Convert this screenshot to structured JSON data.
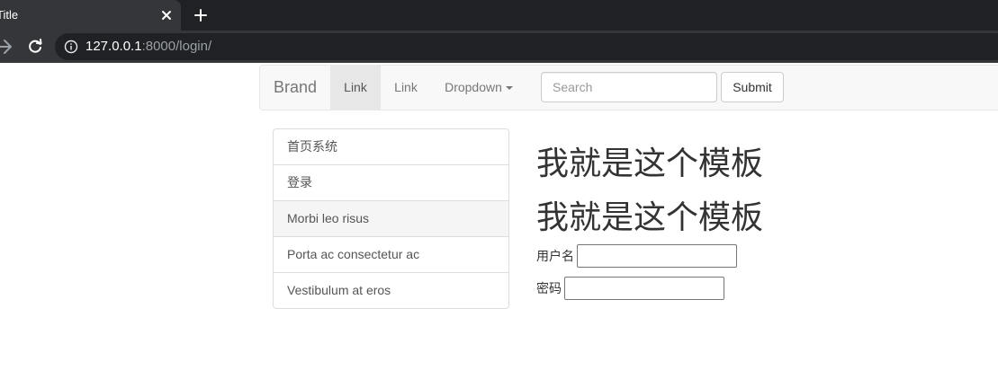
{
  "browser": {
    "tab_title": "Title",
    "url_host": "127.0.0.1",
    "url_rest": ":8000/login/"
  },
  "navbar": {
    "brand": "Brand",
    "links": [
      "Link",
      "Link"
    ],
    "dropdown_label": "Dropdown",
    "search_placeholder": "Search",
    "submit_label": "Submit"
  },
  "sidebar": {
    "items": [
      "首页系统",
      "登录",
      "Morbi leo risus",
      "Porta ac consectetur ac",
      "Vestibulum at eros"
    ]
  },
  "main": {
    "heading_1": "我就是这个模板",
    "heading_2": "我就是这个模板",
    "username_label": "用户名",
    "password_label": "密码"
  },
  "colors": {
    "tabbar": "#202124",
    "toolbar": "#35363a",
    "navbar_bg": "#f8f8f8",
    "nav_active_bg": "#e7e7e7",
    "text": "#333333"
  }
}
